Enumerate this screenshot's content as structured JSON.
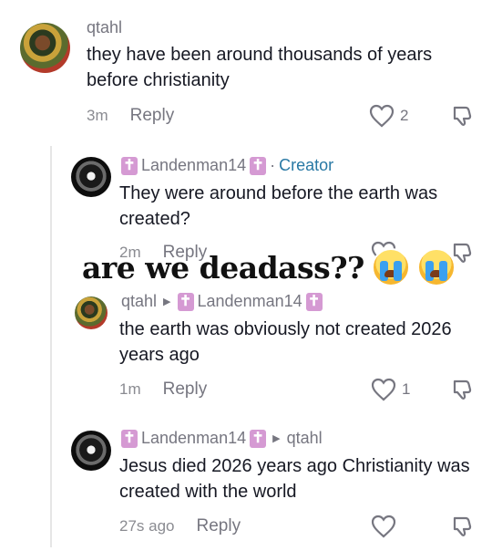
{
  "comments": [
    {
      "username": "qtahl",
      "text": "they have been around thousands of years before christianity",
      "time": "3m",
      "reply_label": "Reply",
      "likes": "2"
    },
    {
      "username": "Landenman14",
      "badge": "Creator",
      "text": "They were around before the earth was created?",
      "time": "2m",
      "reply_label": "Reply",
      "likes": ""
    },
    {
      "username": "qtahl",
      "reply_to": "Landenman14",
      "text": "the earth was obviously not created 2026 years ago",
      "time": "1m",
      "reply_label": "Reply",
      "likes": "1"
    },
    {
      "username": "Landenman14",
      "reply_to": "qtahl",
      "text": "Jesus died 2026 years ago Christianity was created with the world",
      "time": "27s ago",
      "reply_label": "Reply",
      "likes": ""
    }
  ],
  "overlay": {
    "caption": "are we deadass??",
    "emoji": "loudly-crying-face"
  },
  "colors": {
    "creator": "#2878a4",
    "cross_badge": "#d59ad3",
    "text": "#161823",
    "muted": "#767680"
  },
  "icons": {
    "like": "heart-outline-icon",
    "dislike": "thumbs-down-icon",
    "cross": "latin-cross-icon",
    "reply_arrow": "triangle-right-icon"
  }
}
